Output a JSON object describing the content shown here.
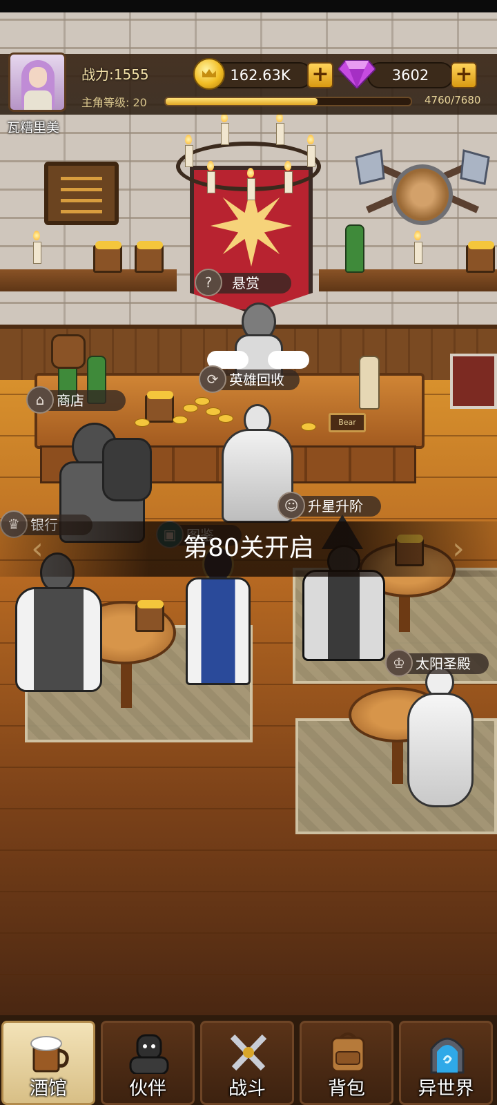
{
  "player": {
    "name": "瓦糟里美",
    "power_label": "战力:1555",
    "level_label": "主角等级: 20",
    "exp_text": "4760/7680",
    "exp_fraction": 0.62
  },
  "resources": {
    "gold": "162.63K",
    "gems": "3602",
    "plus_label": "+"
  },
  "stations": {
    "bounty": "悬赏",
    "hero_recycle": "英雄回收",
    "shop": "商店",
    "bank": "银行",
    "upgrade_star": "升星升阶",
    "codex": "图鉴",
    "sun_temple": "太阳圣殿"
  },
  "decor": {
    "beer_sign": "Bear"
  },
  "stage_banner": "第80关开启",
  "nav": {
    "tabs": [
      {
        "label": "酒馆",
        "icon": "beer-mug-icon",
        "active": true
      },
      {
        "label": "伙伴",
        "icon": "companion-icon",
        "active": false
      },
      {
        "label": "战斗",
        "icon": "crossed-swords-icon",
        "active": false
      },
      {
        "label": "背包",
        "icon": "backpack-icon",
        "active": false
      },
      {
        "label": "异世界",
        "icon": "portal-icon",
        "active": false
      }
    ]
  },
  "colors": {
    "gold": "#f4c63c",
    "gem": "#c64be0",
    "banner_red": "#b82330",
    "hud_text": "#f3e1a8"
  }
}
